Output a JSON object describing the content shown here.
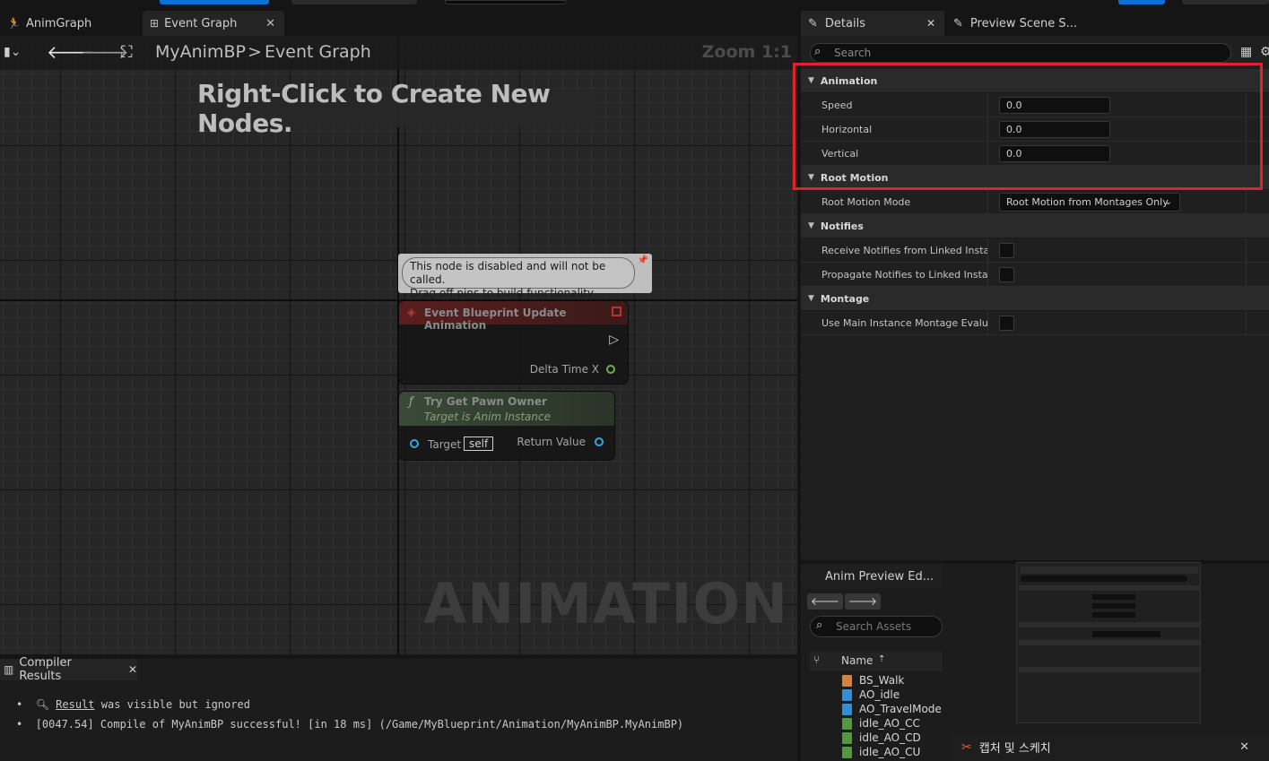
{
  "tabs": [
    {
      "label": "AnimGraph",
      "icon": "anim-icon"
    },
    {
      "label": "Event Graph",
      "icon": "graph-icon",
      "close": "✕"
    }
  ],
  "graph": {
    "breadcrumb_root": "MyAnimBP",
    "breadcrumb_sep": ">",
    "breadcrumb_current": "Event Graph",
    "zoom": "Zoom 1:1",
    "hint": "Right-Click to Create New Nodes.",
    "watermark": "ANIMATION"
  },
  "comment": {
    "line1": "This node is disabled and will not be called.",
    "line2": "Drag off pins to build functionality."
  },
  "event_node": {
    "title": "Event Blueprint Update Animation",
    "pin_delta": "Delta Time X"
  },
  "pawn_node": {
    "title": "Try Get Pawn Owner",
    "subtitle": "Target is Anim Instance",
    "pin_target": "Target",
    "target_value": "self",
    "pin_return": "Return Value"
  },
  "compiler": {
    "tab_label": "Compiler Results",
    "close": "✕",
    "line1_link": "Result",
    "line1_rest": " was visible but ignored",
    "line2": "[0047.54] Compile of MyAnimBP successful! [in 18 ms] (/Game/MyBlueprint/Animation/MyAnimBP.MyAnimBP)"
  },
  "details": {
    "tab_label": "Details",
    "tab2_label": "Preview Scene S...",
    "close": "✕",
    "search_placeholder": "Search",
    "sections": {
      "animation": "Animation",
      "root_motion": "Root Motion",
      "notifies": "Notifies",
      "montage": "Montage"
    },
    "props": {
      "speed_label": "Speed",
      "speed_value": "0.0",
      "horizontal_label": "Horizontal",
      "horizontal_value": "0.0",
      "vertical_label": "Vertical",
      "vertical_value": "0.0",
      "root_motion_mode_label": "Root Motion Mode",
      "root_motion_mode_value": "Root Motion from Montages Only",
      "receive_notifies_label": "Receive Notifies from Linked Insta...",
      "propagate_notifies_label": "Propagate Notifies to Linked Instan...",
      "use_main_instance_label": "Use Main Instance Montage Evalua..."
    }
  },
  "assets": {
    "tab_label": "Anim Preview Ed...",
    "search_placeholder": "Search Assets",
    "col_name": "Name",
    "items": [
      {
        "name": "BS_Walk",
        "color": "#d9803a"
      },
      {
        "name": "AO_idle",
        "color": "#2f8fd8"
      },
      {
        "name": "AO_TravelMode",
        "color": "#2f8fd8"
      },
      {
        "name": "idle_AO_CC",
        "color": "#4f9a3a"
      },
      {
        "name": "idle_AO_CD",
        "color": "#4f9a3a"
      },
      {
        "name": "idle_AO_CU",
        "color": "#4f9a3a"
      }
    ]
  },
  "toast": {
    "label": "캡처 및 스케치",
    "close": "✕"
  },
  "colors": {
    "highlight": "#e0232b",
    "accent_blue": "#0e6fd6"
  }
}
